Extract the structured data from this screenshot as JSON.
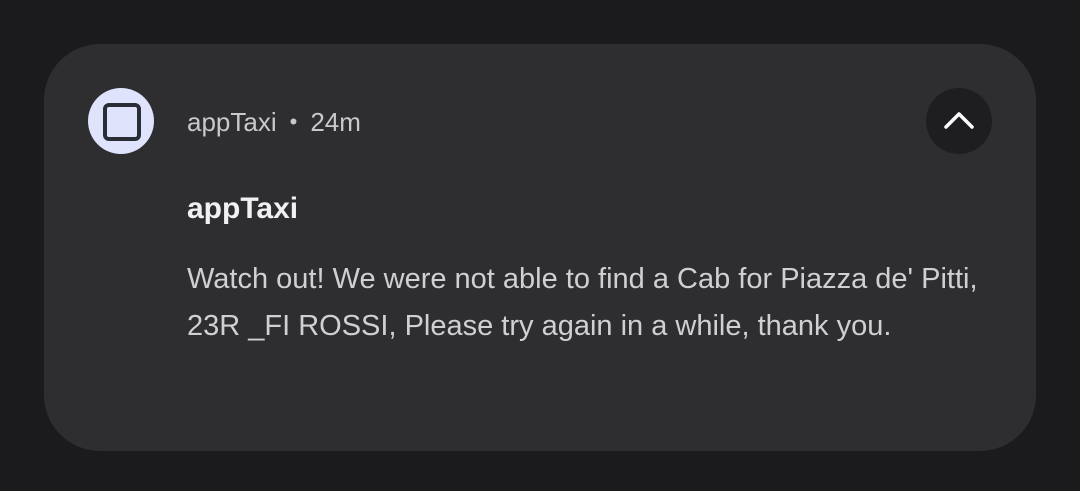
{
  "notification": {
    "app_name": "appTaxi",
    "separator": "•",
    "time": "24m",
    "title": "appTaxi",
    "message": "Watch out! We were not able to find a Cab for Piazza de' Pitti, 23R _FI ROSSI, Please try again in a while, thank you.",
    "icons": {
      "app": "app-square-icon",
      "expand": "chevron-up-icon"
    },
    "colors": {
      "card": "#2e2e30",
      "background": "#1b1b1d",
      "app_icon": "#dfe3fb"
    }
  }
}
